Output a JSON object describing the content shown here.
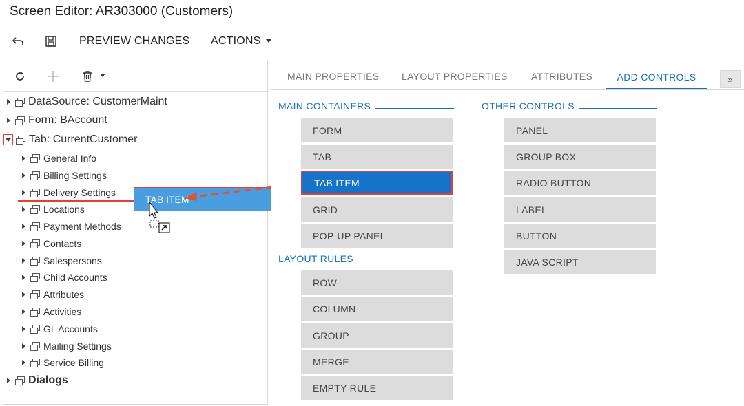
{
  "window": {
    "title": "Screen Editor: AR303000 (Customers)"
  },
  "toolbar": {
    "undo_icon": "undo-icon",
    "save_icon": "save-icon",
    "preview_label": "PREVIEW CHANGES",
    "actions_label": "ACTIONS"
  },
  "tree_toolbar": {
    "refresh_icon": "refresh-icon",
    "add_icon": "plus-icon",
    "delete_icon": "trash-icon"
  },
  "tree": {
    "top_nodes": [
      {
        "label": "DataSource: CustomerMaint"
      },
      {
        "label": "Form: BAccount"
      },
      {
        "label": "Tab: CurrentCustomer"
      }
    ],
    "children": [
      {
        "label": "General Info"
      },
      {
        "label": "Billing Settings"
      },
      {
        "label": "Delivery Settings"
      },
      {
        "label": "Locations"
      },
      {
        "label": "Payment Methods"
      },
      {
        "label": "Contacts"
      },
      {
        "label": "Salespersons"
      },
      {
        "label": "Child Accounts"
      },
      {
        "label": "Attributes"
      },
      {
        "label": "Activities"
      },
      {
        "label": "GL Accounts"
      },
      {
        "label": "Mailing Settings"
      },
      {
        "label": "Service Billing"
      }
    ],
    "last_node": {
      "label": "Dialogs"
    }
  },
  "drag": {
    "ghost_label": "TAB ITEM"
  },
  "tabs": [
    {
      "label": "MAIN PROPERTIES"
    },
    {
      "label": "LAYOUT PROPERTIES"
    },
    {
      "label": "ATTRIBUTES"
    },
    {
      "label": "ADD CONTROLS"
    }
  ],
  "tab_more_icon": "double-chevron-icon",
  "sections": {
    "main_containers": {
      "title": "MAIN CONTAINERS",
      "items": [
        "FORM",
        "TAB",
        "TAB ITEM",
        "GRID",
        "POP-UP PANEL"
      ]
    },
    "layout_rules": {
      "title": "LAYOUT RULES",
      "items": [
        "ROW",
        "COLUMN",
        "GROUP",
        "MERGE",
        "EMPTY RULE"
      ]
    },
    "other_controls": {
      "title": "OTHER CONTROLS",
      "items": [
        "PANEL",
        "GROUP BOX",
        "RADIO BUTTON",
        "LABEL",
        "BUTTON",
        "JAVA SCRIPT"
      ]
    }
  },
  "colors": {
    "accent": "#1a6fbd",
    "selected": "#1773c9",
    "highlight": "#e0413a",
    "button_bg": "#dcdcdc"
  }
}
